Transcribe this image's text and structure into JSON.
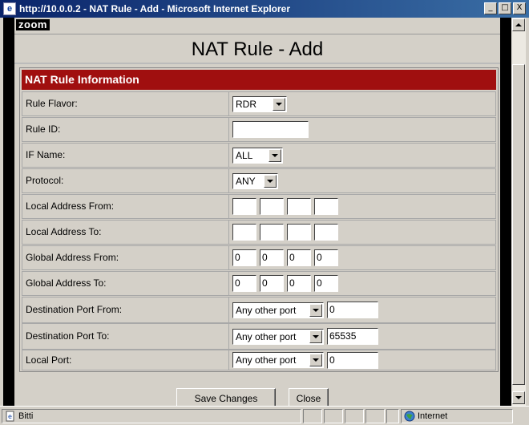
{
  "window": {
    "title": "http://10.0.0.2 - NAT Rule - Add - Microsoft Internet Explorer",
    "minimize": "_",
    "maximize": "□",
    "close": "X"
  },
  "page": {
    "logo": "zoom",
    "title": "NAT Rule - Add"
  },
  "panel": {
    "header": "NAT Rule Information"
  },
  "form": {
    "rule_flavor": {
      "label": "Rule Flavor:",
      "value": "RDR"
    },
    "rule_id": {
      "label": "Rule ID:",
      "value": ""
    },
    "if_name": {
      "label": "IF Name:",
      "value": "ALL"
    },
    "protocol": {
      "label": "Protocol:",
      "value": "ANY"
    },
    "local_from": {
      "label": "Local Address From:",
      "octets": [
        "",
        "",
        "",
        ""
      ]
    },
    "local_to": {
      "label": "Local Address To:",
      "octets": [
        "",
        "",
        "",
        ""
      ]
    },
    "global_from": {
      "label": "Global Address From:",
      "octets": [
        "0",
        "0",
        "0",
        "0"
      ]
    },
    "global_to": {
      "label": "Global Address To:",
      "octets": [
        "0",
        "0",
        "0",
        "0"
      ]
    },
    "dest_from": {
      "label": "Destination Port From:",
      "select": "Any other port",
      "value": "0"
    },
    "dest_to": {
      "label": "Destination Port To:",
      "select": "Any other port",
      "value": "65535"
    },
    "local_port": {
      "label": "Local Port:",
      "select": "Any other port",
      "value": "0"
    }
  },
  "buttons": {
    "save": "Save Changes",
    "close": "Close"
  },
  "status": {
    "text": "Bitti",
    "zone": "Internet"
  },
  "colors": {
    "header": "#a00f0f",
    "titlebar": "#0a246a"
  }
}
